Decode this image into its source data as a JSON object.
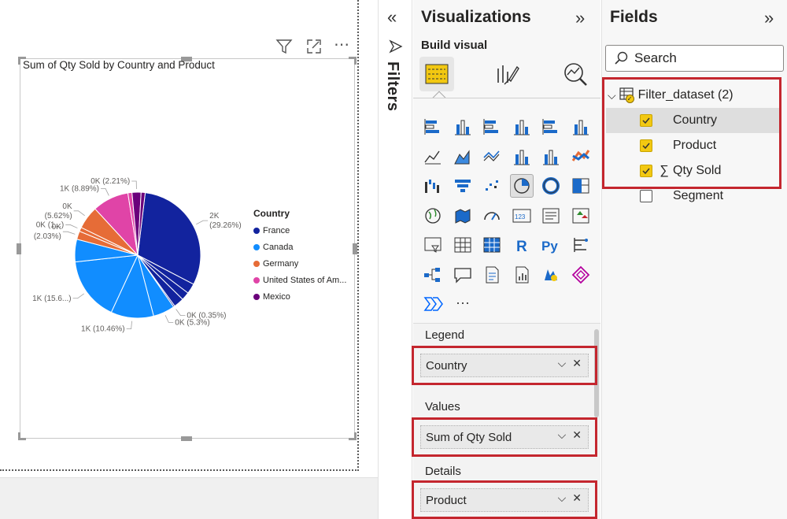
{
  "canvas": {
    "visual_title": "Sum of Qty Sold by Country and Product",
    "header_icons": [
      "filter-icon",
      "focus-mode-icon",
      "more-options-icon"
    ]
  },
  "chart_data": {
    "type": "pie",
    "title": "Sum of Qty Sold by Country and Product",
    "legend_title": "Country",
    "legend_position": "right",
    "series": [
      {
        "name": "France",
        "color": "#12239e"
      },
      {
        "name": "Canada",
        "color": "#118dff"
      },
      {
        "name": "Germany",
        "color": "#e66c37"
      },
      {
        "name": "United States of Am...",
        "color": "#e044a7"
      },
      {
        "name": "Mexico",
        "color": "#6b007b"
      }
    ],
    "slices": [
      {
        "country": "France",
        "percent": 29.26,
        "label": "2K\n(29.26%)"
      },
      {
        "country": "France",
        "percent": 2.5,
        "label": ""
      },
      {
        "country": "France",
        "percent": 2.0,
        "label": ""
      },
      {
        "country": "France",
        "percent": 2.5,
        "label": ""
      },
      {
        "country": "France",
        "percent": 0.35,
        "label": "0K (0.35%)"
      },
      {
        "country": "Canada",
        "percent": 5.3,
        "label": "0K (5.3%)"
      },
      {
        "country": "Canada",
        "percent": 10.46,
        "label": "1K (10.46%)"
      },
      {
        "country": "Canada",
        "percent": 15.6,
        "label": "1K (15.6...)"
      },
      {
        "country": "Canada",
        "percent": 5.5,
        "label": ""
      },
      {
        "country": "Germany",
        "percent": 2.03,
        "label": "0K\n(2.03%)"
      },
      {
        "country": "Germany",
        "percent": 1.0,
        "label": "0K (1...)"
      },
      {
        "country": "Germany",
        "percent": 5.62,
        "label": "0K\n(5.62%)"
      },
      {
        "country": "United States of Am...",
        "percent": 8.89,
        "label": "1K (8.89%)"
      },
      {
        "country": "United States of Am...",
        "percent": 1.0,
        "label": ""
      },
      {
        "country": "Mexico",
        "percent": 2.21,
        "label": "0K (2.21%)"
      },
      {
        "country": "Mexico",
        "percent": 1.0,
        "label": ""
      }
    ]
  },
  "filters_pane": {
    "label": "Filters",
    "collapse_icon": "chevron-double-left-icon",
    "filter_icon": "funnel-icon"
  },
  "visualizations": {
    "title": "Visualizations",
    "build_visual_label": "Build visual",
    "legend_label": "Legend",
    "legend_value": "Country",
    "values_label": "Values",
    "values_value": "Sum of Qty Sold",
    "details_label": "Details",
    "details_value": "Product"
  },
  "fields": {
    "title": "Fields",
    "search_placeholder": "Search",
    "table_name": "Filter_dataset (2)",
    "items": [
      {
        "label": "Country",
        "checked": true,
        "sigma": false
      },
      {
        "label": "Product",
        "checked": true,
        "sigma": false
      },
      {
        "label": "Qty Sold",
        "checked": true,
        "sigma": true
      },
      {
        "label": "Segment",
        "checked": false,
        "sigma": false
      }
    ]
  },
  "colors": {
    "accent_red": "#c4262e",
    "checkbox_yellow": "#f2c811"
  }
}
